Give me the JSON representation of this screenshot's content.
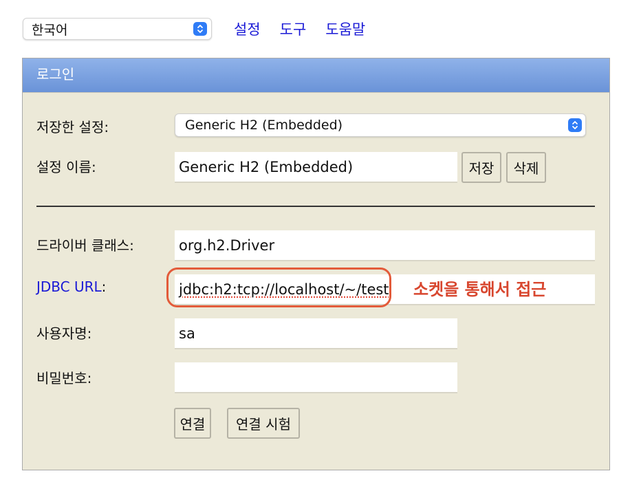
{
  "top": {
    "language_select": "한국어",
    "links": [
      "설정",
      "도구",
      "도움말"
    ]
  },
  "panel": {
    "title": "로그인",
    "saved_settings": {
      "label": "저장한 설정:",
      "value": "Generic H2 (Embedded)"
    },
    "setting_name": {
      "label": "설정 이름:",
      "value": "Generic H2 (Embedded)",
      "save_button": "저장",
      "delete_button": "삭제"
    },
    "driver_class": {
      "label": "드라이버 클래스:",
      "value": "org.h2.Driver"
    },
    "jdbc_url": {
      "label_link": "JDBC URL",
      "label_suffix": ":",
      "value": "jdbc:h2:tcp://localhost/~/test"
    },
    "username": {
      "label": "사용자명:",
      "value": "sa"
    },
    "password": {
      "label": "비밀번호:",
      "value": ""
    },
    "connect_button": "연결",
    "test_connection_button": "연결 시험"
  },
  "annotation": {
    "text": "소켓을 통해서 접근",
    "color": "#d8472f"
  },
  "colors": {
    "header_gradient_top": "#8fb2e9",
    "panel_background": "#ece9d8",
    "link": "#1a1ad6"
  }
}
